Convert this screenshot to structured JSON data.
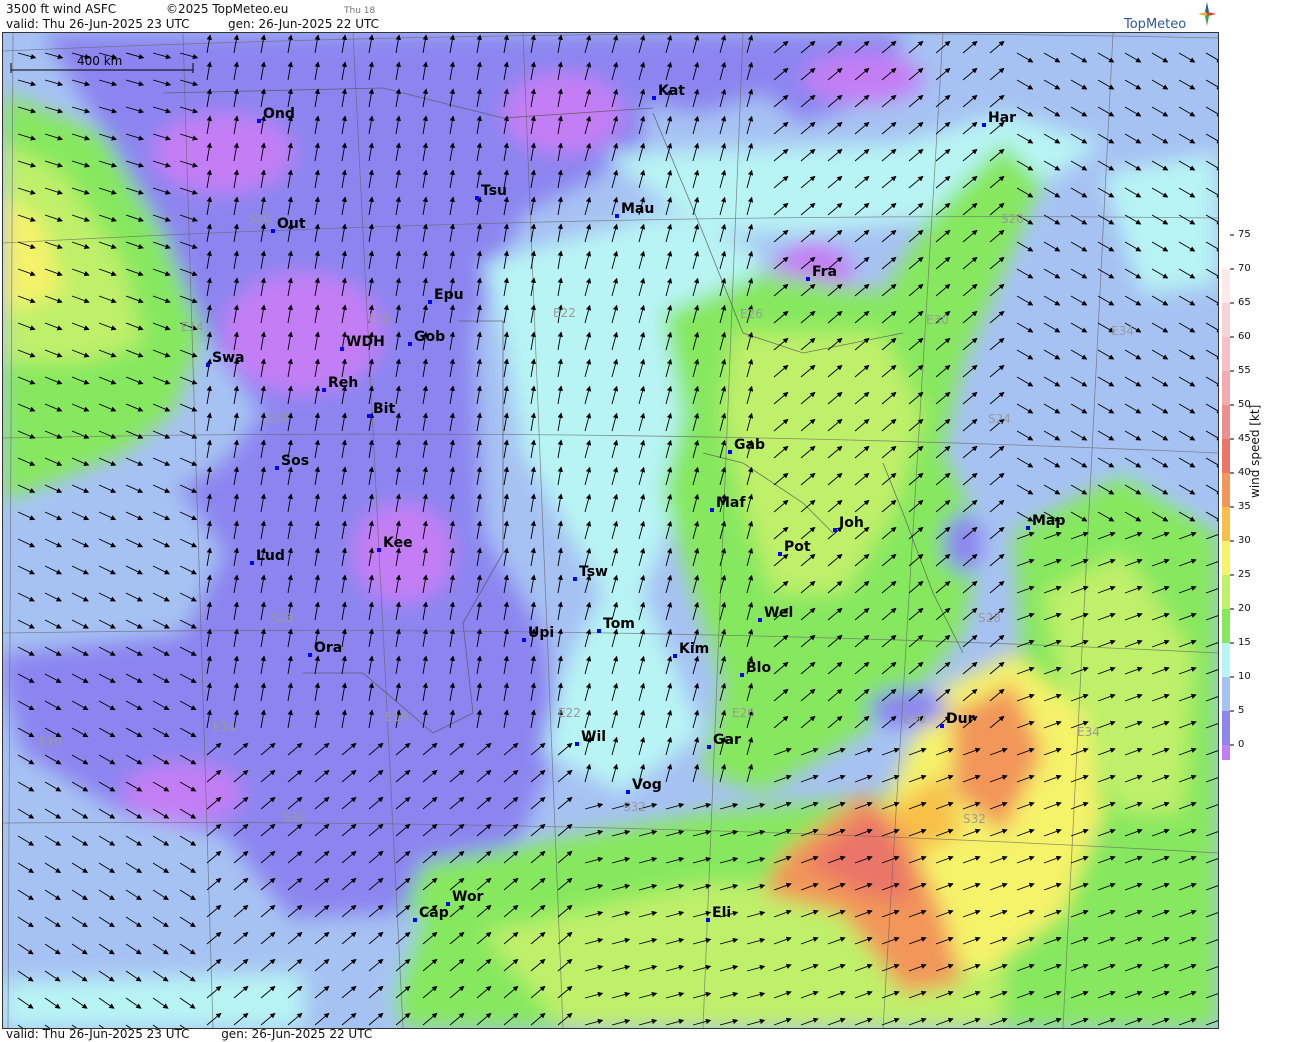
{
  "header": {
    "product": "3500 ft wind ASFC",
    "copyright": "©2025 TopMeteo.eu",
    "day_step": "Thu 18",
    "valid": "valid:  Thu  26-Jun-2025  23 UTC",
    "gen": "gen: 26-Jun-2025 22 UTC"
  },
  "footer": {
    "valid": "valid:  Thu  26-Jun-2025  23 UTC",
    "gen": "gen: 26-Jun-2025 22 UTC"
  },
  "logo": "TopMeteo",
  "scale_bar": "400 km",
  "legend": {
    "title": "wind speed [kt]",
    "ticks": [
      "75",
      "70",
      "65",
      "60",
      "55",
      "50",
      "45",
      "40",
      "35",
      "30",
      "25",
      "20",
      "15",
      "10",
      "5",
      "0"
    ],
    "colors": [
      "#ffffff",
      "#fbe9ec",
      "#f7d4d8",
      "#f5c0c6",
      "#f3abb1",
      "#ee8f8f",
      "#ea7568",
      "#f2965a",
      "#f8c04a",
      "#f5f36a",
      "#bff06a",
      "#86e85e",
      "#b8f4f4",
      "#a6c2f3",
      "#8c85f0",
      "#c47ef5"
    ],
    "accent_colors": {
      "station": "#0000ff",
      "arrow": "#000000",
      "grid": "#555555"
    }
  },
  "stations": [
    {
      "name": "Ond"
    },
    {
      "name": "Kat"
    },
    {
      "name": "Har"
    },
    {
      "name": "Tsu"
    },
    {
      "name": "Mau"
    },
    {
      "name": "Out"
    },
    {
      "name": "Fra"
    },
    {
      "name": "Epu"
    },
    {
      "name": "WDH"
    },
    {
      "name": "Gob"
    },
    {
      "name": "Swa"
    },
    {
      "name": "Reh"
    },
    {
      "name": "Bit"
    },
    {
      "name": "Gab"
    },
    {
      "name": "Sos"
    },
    {
      "name": "Maf"
    },
    {
      "name": "Joh"
    },
    {
      "name": "Map"
    },
    {
      "name": "Kee"
    },
    {
      "name": "Pot"
    },
    {
      "name": "Lud"
    },
    {
      "name": "Tsw"
    },
    {
      "name": "Wel"
    },
    {
      "name": "Tom"
    },
    {
      "name": "Upi"
    },
    {
      "name": "Kim"
    },
    {
      "name": "Ora"
    },
    {
      "name": "Blo"
    },
    {
      "name": "Dur"
    },
    {
      "name": "Wil"
    },
    {
      "name": "Gar"
    },
    {
      "name": "Vog"
    },
    {
      "name": "Wor"
    },
    {
      "name": "Cap"
    },
    {
      "name": "Eli"
    }
  ],
  "grid_labels": [
    "S20",
    "E18",
    "E14",
    "E22",
    "E26",
    "S20",
    "E30",
    "S24",
    "E34",
    "S24",
    "S28",
    "S28",
    "E18",
    "E14",
    "E10",
    "E22",
    "E26",
    "E30",
    "E34",
    "S32",
    "S32",
    "S32"
  ]
}
